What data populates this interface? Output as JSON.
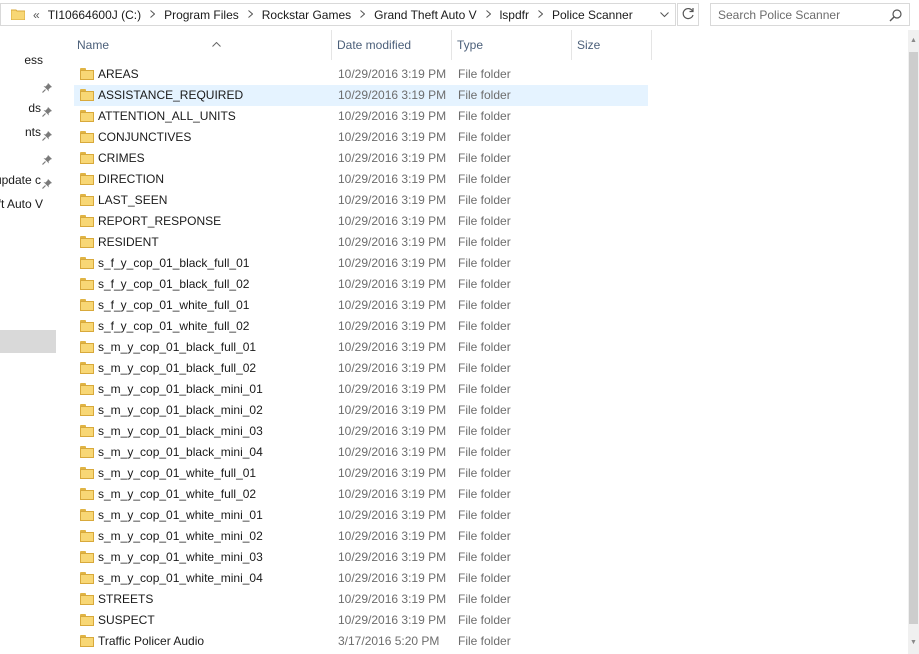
{
  "address_bar": {
    "overflow": "«",
    "crumbs": [
      "TI10664600J (C:)",
      "Program Files",
      "Rockstar Games",
      "Grand Theft Auto V",
      "lspdfr",
      "Police Scanner"
    ]
  },
  "search": {
    "placeholder": "Search Police Scanner"
  },
  "nav": {
    "items": [
      {
        "label": "ess",
        "pinned": false
      },
      {
        "label": "",
        "pinned": true
      },
      {
        "label": "ds",
        "pinned": true
      },
      {
        "label": "nts",
        "pinned": true
      },
      {
        "label": "",
        "pinned": true
      },
      {
        "label": "update c",
        "pinned": true
      },
      {
        "label": "heft Auto V",
        "pinned": false
      }
    ]
  },
  "columns": {
    "name": "Name",
    "date": "Date modified",
    "type": "Type",
    "size": "Size"
  },
  "files": [
    {
      "name": "AREAS",
      "date": "10/29/2016 3:19 PM",
      "type": "File folder"
    },
    {
      "name": "ASSISTANCE_REQUIRED",
      "date": "10/29/2016 3:19 PM",
      "type": "File folder"
    },
    {
      "name": "ATTENTION_ALL_UNITS",
      "date": "10/29/2016 3:19 PM",
      "type": "File folder"
    },
    {
      "name": "CONJUNCTIVES",
      "date": "10/29/2016 3:19 PM",
      "type": "File folder"
    },
    {
      "name": "CRIMES",
      "date": "10/29/2016 3:19 PM",
      "type": "File folder"
    },
    {
      "name": "DIRECTION",
      "date": "10/29/2016 3:19 PM",
      "type": "File folder"
    },
    {
      "name": "LAST_SEEN",
      "date": "10/29/2016 3:19 PM",
      "type": "File folder"
    },
    {
      "name": "REPORT_RESPONSE",
      "date": "10/29/2016 3:19 PM",
      "type": "File folder"
    },
    {
      "name": "RESIDENT",
      "date": "10/29/2016 3:19 PM",
      "type": "File folder"
    },
    {
      "name": "s_f_y_cop_01_black_full_01",
      "date": "10/29/2016 3:19 PM",
      "type": "File folder"
    },
    {
      "name": "s_f_y_cop_01_black_full_02",
      "date": "10/29/2016 3:19 PM",
      "type": "File folder"
    },
    {
      "name": "s_f_y_cop_01_white_full_01",
      "date": "10/29/2016 3:19 PM",
      "type": "File folder"
    },
    {
      "name": "s_f_y_cop_01_white_full_02",
      "date": "10/29/2016 3:19 PM",
      "type": "File folder"
    },
    {
      "name": "s_m_y_cop_01_black_full_01",
      "date": "10/29/2016 3:19 PM",
      "type": "File folder"
    },
    {
      "name": "s_m_y_cop_01_black_full_02",
      "date": "10/29/2016 3:19 PM",
      "type": "File folder"
    },
    {
      "name": "s_m_y_cop_01_black_mini_01",
      "date": "10/29/2016 3:19 PM",
      "type": "File folder"
    },
    {
      "name": "s_m_y_cop_01_black_mini_02",
      "date": "10/29/2016 3:19 PM",
      "type": "File folder"
    },
    {
      "name": "s_m_y_cop_01_black_mini_03",
      "date": "10/29/2016 3:19 PM",
      "type": "File folder"
    },
    {
      "name": "s_m_y_cop_01_black_mini_04",
      "date": "10/29/2016 3:19 PM",
      "type": "File folder"
    },
    {
      "name": "s_m_y_cop_01_white_full_01",
      "date": "10/29/2016 3:19 PM",
      "type": "File folder"
    },
    {
      "name": "s_m_y_cop_01_white_full_02",
      "date": "10/29/2016 3:19 PM",
      "type": "File folder"
    },
    {
      "name": "s_m_y_cop_01_white_mini_01",
      "date": "10/29/2016 3:19 PM",
      "type": "File folder"
    },
    {
      "name": "s_m_y_cop_01_white_mini_02",
      "date": "10/29/2016 3:19 PM",
      "type": "File folder"
    },
    {
      "name": "s_m_y_cop_01_white_mini_03",
      "date": "10/29/2016 3:19 PM",
      "type": "File folder"
    },
    {
      "name": "s_m_y_cop_01_white_mini_04",
      "date": "10/29/2016 3:19 PM",
      "type": "File folder"
    },
    {
      "name": "STREETS",
      "date": "10/29/2016 3:19 PM",
      "type": "File folder"
    },
    {
      "name": "SUSPECT",
      "date": "10/29/2016 3:19 PM",
      "type": "File folder"
    },
    {
      "name": "Traffic Policer Audio",
      "date": "3/17/2016 5:20 PM",
      "type": "File folder"
    }
  ],
  "selected_index": 1,
  "colors": {
    "header_text": "#4c607a",
    "selection": "#e5f3ff",
    "folder": "#f8d775"
  },
  "icons": {
    "folder": "folder-icon",
    "search": "search-icon",
    "refresh": "refresh-icon",
    "dropdown": "chevron-down-icon",
    "pin": "pin-icon",
    "sort": "sort-up-icon"
  }
}
